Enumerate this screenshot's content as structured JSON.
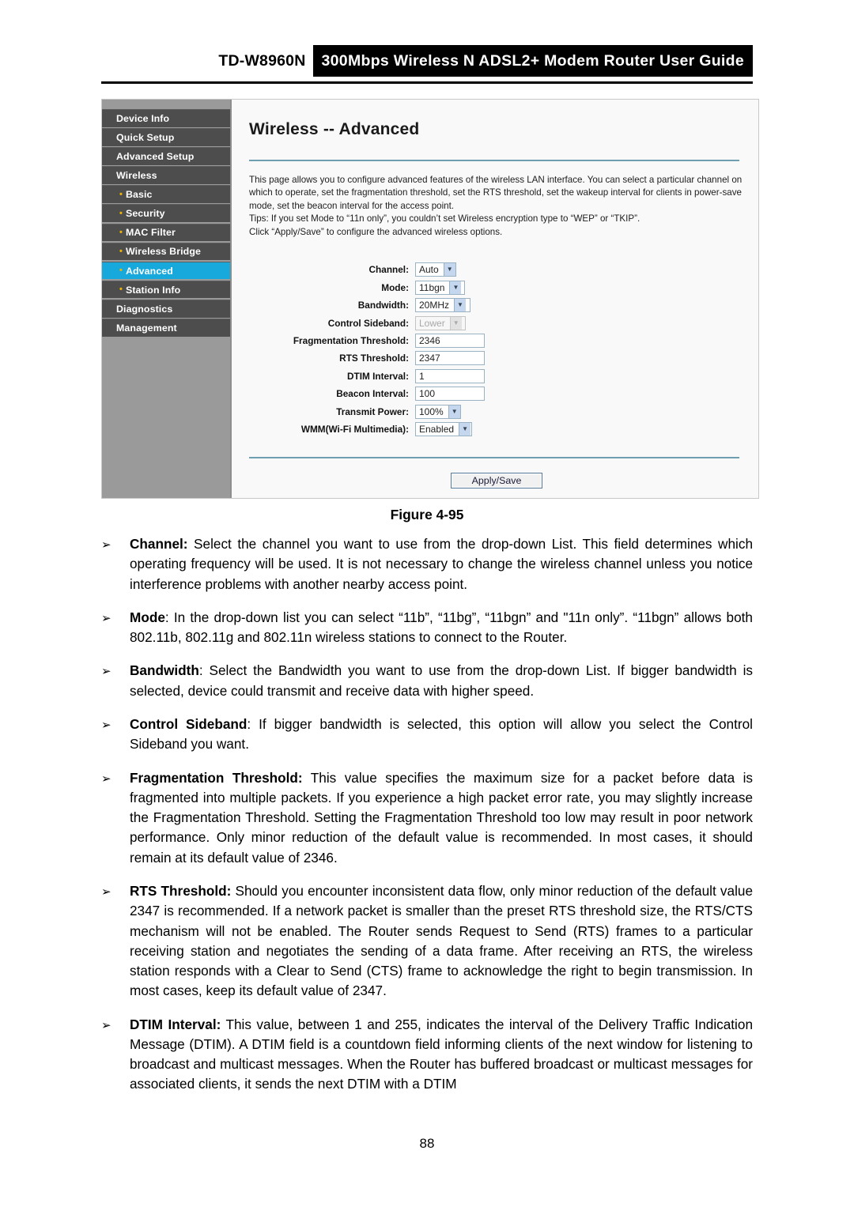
{
  "header": {
    "model": "TD-W8960N",
    "title": "300Mbps Wireless N ADSL2+ Modem Router User Guide"
  },
  "figure": {
    "caption": "Figure 4-95",
    "sidebar": {
      "items": [
        {
          "label": "Device Info",
          "sub": false,
          "active": false
        },
        {
          "label": "Quick Setup",
          "sub": false,
          "active": false
        },
        {
          "label": "Advanced Setup",
          "sub": false,
          "active": false
        },
        {
          "label": "Wireless",
          "sub": false,
          "active": false
        },
        {
          "label": "Basic",
          "sub": true,
          "active": false
        },
        {
          "label": "Security",
          "sub": true,
          "active": false
        },
        {
          "label": "MAC Filter",
          "sub": true,
          "active": false
        },
        {
          "label": "Wireless Bridge",
          "sub": true,
          "active": false
        },
        {
          "label": "Advanced",
          "sub": true,
          "active": true
        },
        {
          "label": "Station Info",
          "sub": true,
          "active": false
        },
        {
          "label": "Diagnostics",
          "sub": false,
          "active": false
        },
        {
          "label": "Management",
          "sub": false,
          "active": false
        }
      ],
      "bullet_glyph": "•",
      "active_color": "#17a8dc",
      "item_color": "#4d4d4d",
      "bullet_color": "#f0b400"
    },
    "panel": {
      "heading": "Wireless -- Advanced",
      "description_line1": "This page allows you to configure advanced features of the wireless LAN interface. You can select a particular channel on which to operate, set the fragmentation threshold, set the RTS threshold, set the wakeup interval for clients in power-save mode, set the beacon interval for the access point.",
      "description_line2": "Tips: If you set Mode to “11n only”, you couldn’t set Wireless encryption type to “WEP” or “TKIP”.",
      "description_line3": "Click “Apply/Save” to configure the advanced wireless options.",
      "divider_color": "#6d9fb0",
      "fields": {
        "channel": {
          "label": "Channel:",
          "value": "Auto",
          "type": "select",
          "disabled": false
        },
        "mode": {
          "label": "Mode:",
          "value": "11bgn",
          "type": "select",
          "disabled": false
        },
        "bandwidth": {
          "label": "Bandwidth:",
          "value": "20MHz",
          "type": "select",
          "disabled": false
        },
        "sideband": {
          "label": "Control Sideband:",
          "value": "Lower",
          "type": "select",
          "disabled": true
        },
        "frag": {
          "label": "Fragmentation Threshold:",
          "value": "2346",
          "type": "text",
          "disabled": false
        },
        "rts": {
          "label": "RTS Threshold:",
          "value": "2347",
          "type": "text",
          "disabled": false
        },
        "dtim": {
          "label": "DTIM Interval:",
          "value": "1",
          "type": "text",
          "disabled": false
        },
        "beacon": {
          "label": "Beacon Interval:",
          "value": "100",
          "type": "text",
          "disabled": false
        },
        "txpower": {
          "label": "Transmit Power:",
          "value": "100%",
          "type": "select",
          "disabled": false
        },
        "wmm": {
          "label": "WMM(Wi-Fi Multimedia):",
          "value": "Enabled",
          "type": "select",
          "disabled": false
        }
      },
      "apply_button": "Apply/Save",
      "dropdown_arrow": "▼"
    }
  },
  "content": {
    "bullet_glyph": "➢",
    "paragraphs": [
      {
        "term": "Channel:",
        "text": " Select the channel you want to use from the drop-down List. This field determines which operating frequency will be used. It is not necessary to change the wireless channel unless you notice interference problems with another nearby access point."
      },
      {
        "term": "Mode",
        "text": ": In the drop-down list you can select “11b”, “11bg”, “11bgn” and \"11n only”. “11bgn” allows both 802.11b, 802.11g and 802.11n wireless stations to connect to the Router."
      },
      {
        "term": "Bandwidth",
        "text": ": Select the Bandwidth you want to use from the drop-down List. If bigger bandwidth is selected, device could transmit and receive data with higher speed."
      },
      {
        "term": "Control Sideband",
        "text": ": If bigger bandwidth is selected, this option will allow you select the Control Sideband you want."
      },
      {
        "term": "Fragmentation Threshold:",
        "text": " This value specifies the maximum size for a packet before data is fragmented into multiple packets. If you experience a high packet error rate, you may slightly increase the Fragmentation Threshold. Setting the Fragmentation Threshold too low may result in poor network performance. Only minor reduction of the default value is recommended. In most cases, it should remain at its default value of 2346."
      },
      {
        "term": "RTS Threshold:",
        "text": " Should you encounter inconsistent data flow, only minor reduction of the default value 2347 is recommended. If a network packet is smaller than the preset RTS threshold size, the RTS/CTS mechanism will not be enabled. The Router sends Request to Send (RTS) frames to a particular receiving station and negotiates the sending of a data frame. After receiving an RTS, the wireless station responds with a Clear to Send (CTS) frame to acknowledge the right to begin transmission. In most cases, keep its default value of 2347."
      },
      {
        "term": "DTIM Interval:",
        "text": " This value, between 1 and 255, indicates the interval of the Delivery Traffic Indication Message (DTIM). A DTIM field is a countdown field informing clients of the next window for listening to broadcast and multicast messages. When the Router has buffered broadcast or multicast messages for associated clients, it sends the next DTIM with a DTIM"
      }
    ]
  },
  "footer": {
    "page_number": "88"
  }
}
